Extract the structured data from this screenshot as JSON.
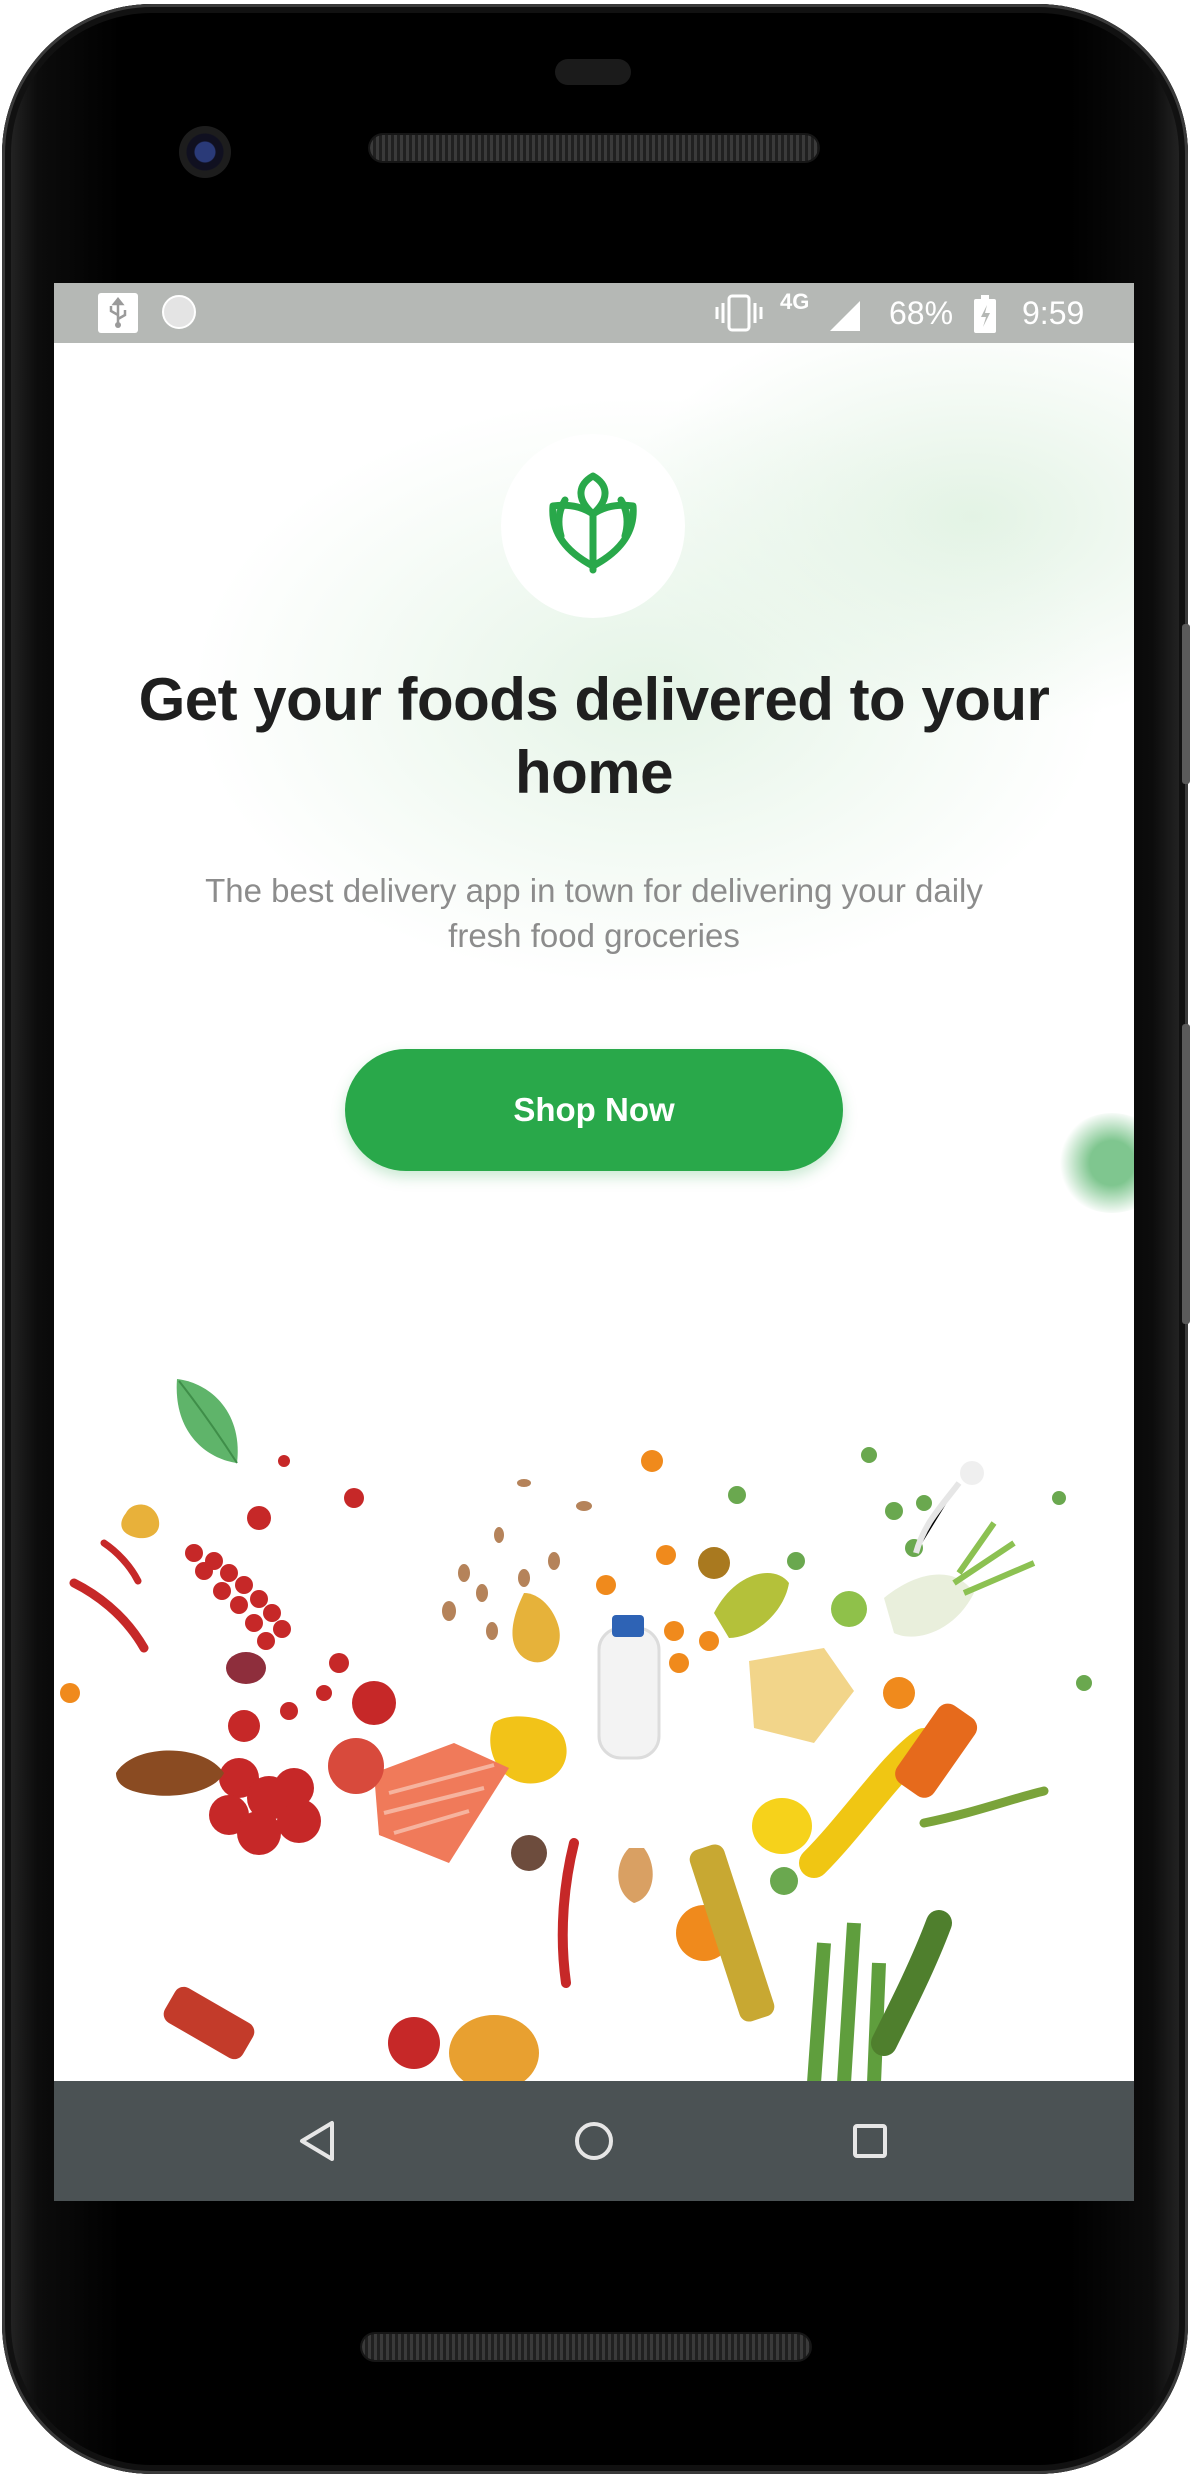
{
  "status_bar": {
    "network": "4G",
    "battery_percent": "68%",
    "time": "9:59",
    "icons": [
      "usb-icon",
      "circle-icon",
      "vibrate-icon",
      "signal-icon",
      "battery-icon"
    ]
  },
  "onboarding": {
    "logo_icon": "wheat-leaf-icon",
    "headline": "Get your foods delivered to your home",
    "subtext": "The best delivery app in town for delivering your daily fresh food groceries",
    "cta_label": "Shop Now"
  },
  "navigation": {
    "back_icon": "back-triangle-icon",
    "home_icon": "home-circle-icon",
    "recents_icon": "recents-square-icon"
  },
  "colors": {
    "accent": "#29a84a",
    "headline": "#1f1f1f",
    "subtext": "#8c8c8c",
    "status_bar": "#b5b8b5",
    "nav_bar": "#4b5254"
  }
}
